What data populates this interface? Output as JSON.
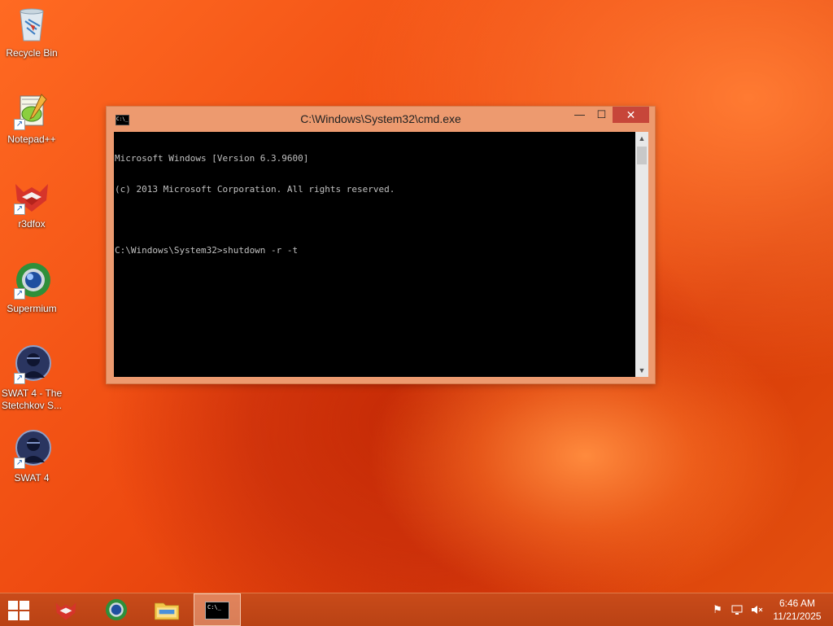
{
  "desktop": {
    "icons": [
      {
        "label": "Recycle Bin",
        "icon": "recycle-bin-icon"
      },
      {
        "label": "Notepad++",
        "icon": "notepad-plus-plus-icon"
      },
      {
        "label": "r3dfox",
        "icon": "r3dfox-icon"
      },
      {
        "label": "Supermium",
        "icon": "supermium-icon"
      },
      {
        "label": "SWAT 4 - The Stetchkov S...",
        "icon": "swat4-icon"
      },
      {
        "label": "SWAT 4",
        "icon": "swat4-icon"
      }
    ]
  },
  "cmd": {
    "title": "C:\\Windows\\System32\\cmd.exe",
    "icon_text": "C:\\_",
    "buttons": {
      "minimize": "—",
      "maximize": "☐",
      "close": "✕"
    },
    "lines": [
      "Microsoft Windows [Version 6.3.9600]",
      "(c) 2013 Microsoft Corporation. All rights reserved.",
      "",
      "C:\\Windows\\System32>shutdown -r -t"
    ]
  },
  "taskbar": {
    "items": [
      {
        "name": "r3dfox",
        "icon": "r3dfox-icon"
      },
      {
        "name": "Supermium",
        "icon": "supermium-icon"
      },
      {
        "name": "File Explorer",
        "icon": "file-explorer-icon"
      },
      {
        "name": "Command Prompt",
        "icon": "command-prompt-icon",
        "active": true
      }
    ],
    "tray": [
      "flag-icon",
      "network-icon",
      "volume-muted-icon"
    ],
    "clock": {
      "time": "6:46 AM",
      "date": "11/21/2025"
    }
  },
  "colors": {
    "accent": "#ed9a6f",
    "close": "#c7463a",
    "taskbar": "#c04616"
  }
}
